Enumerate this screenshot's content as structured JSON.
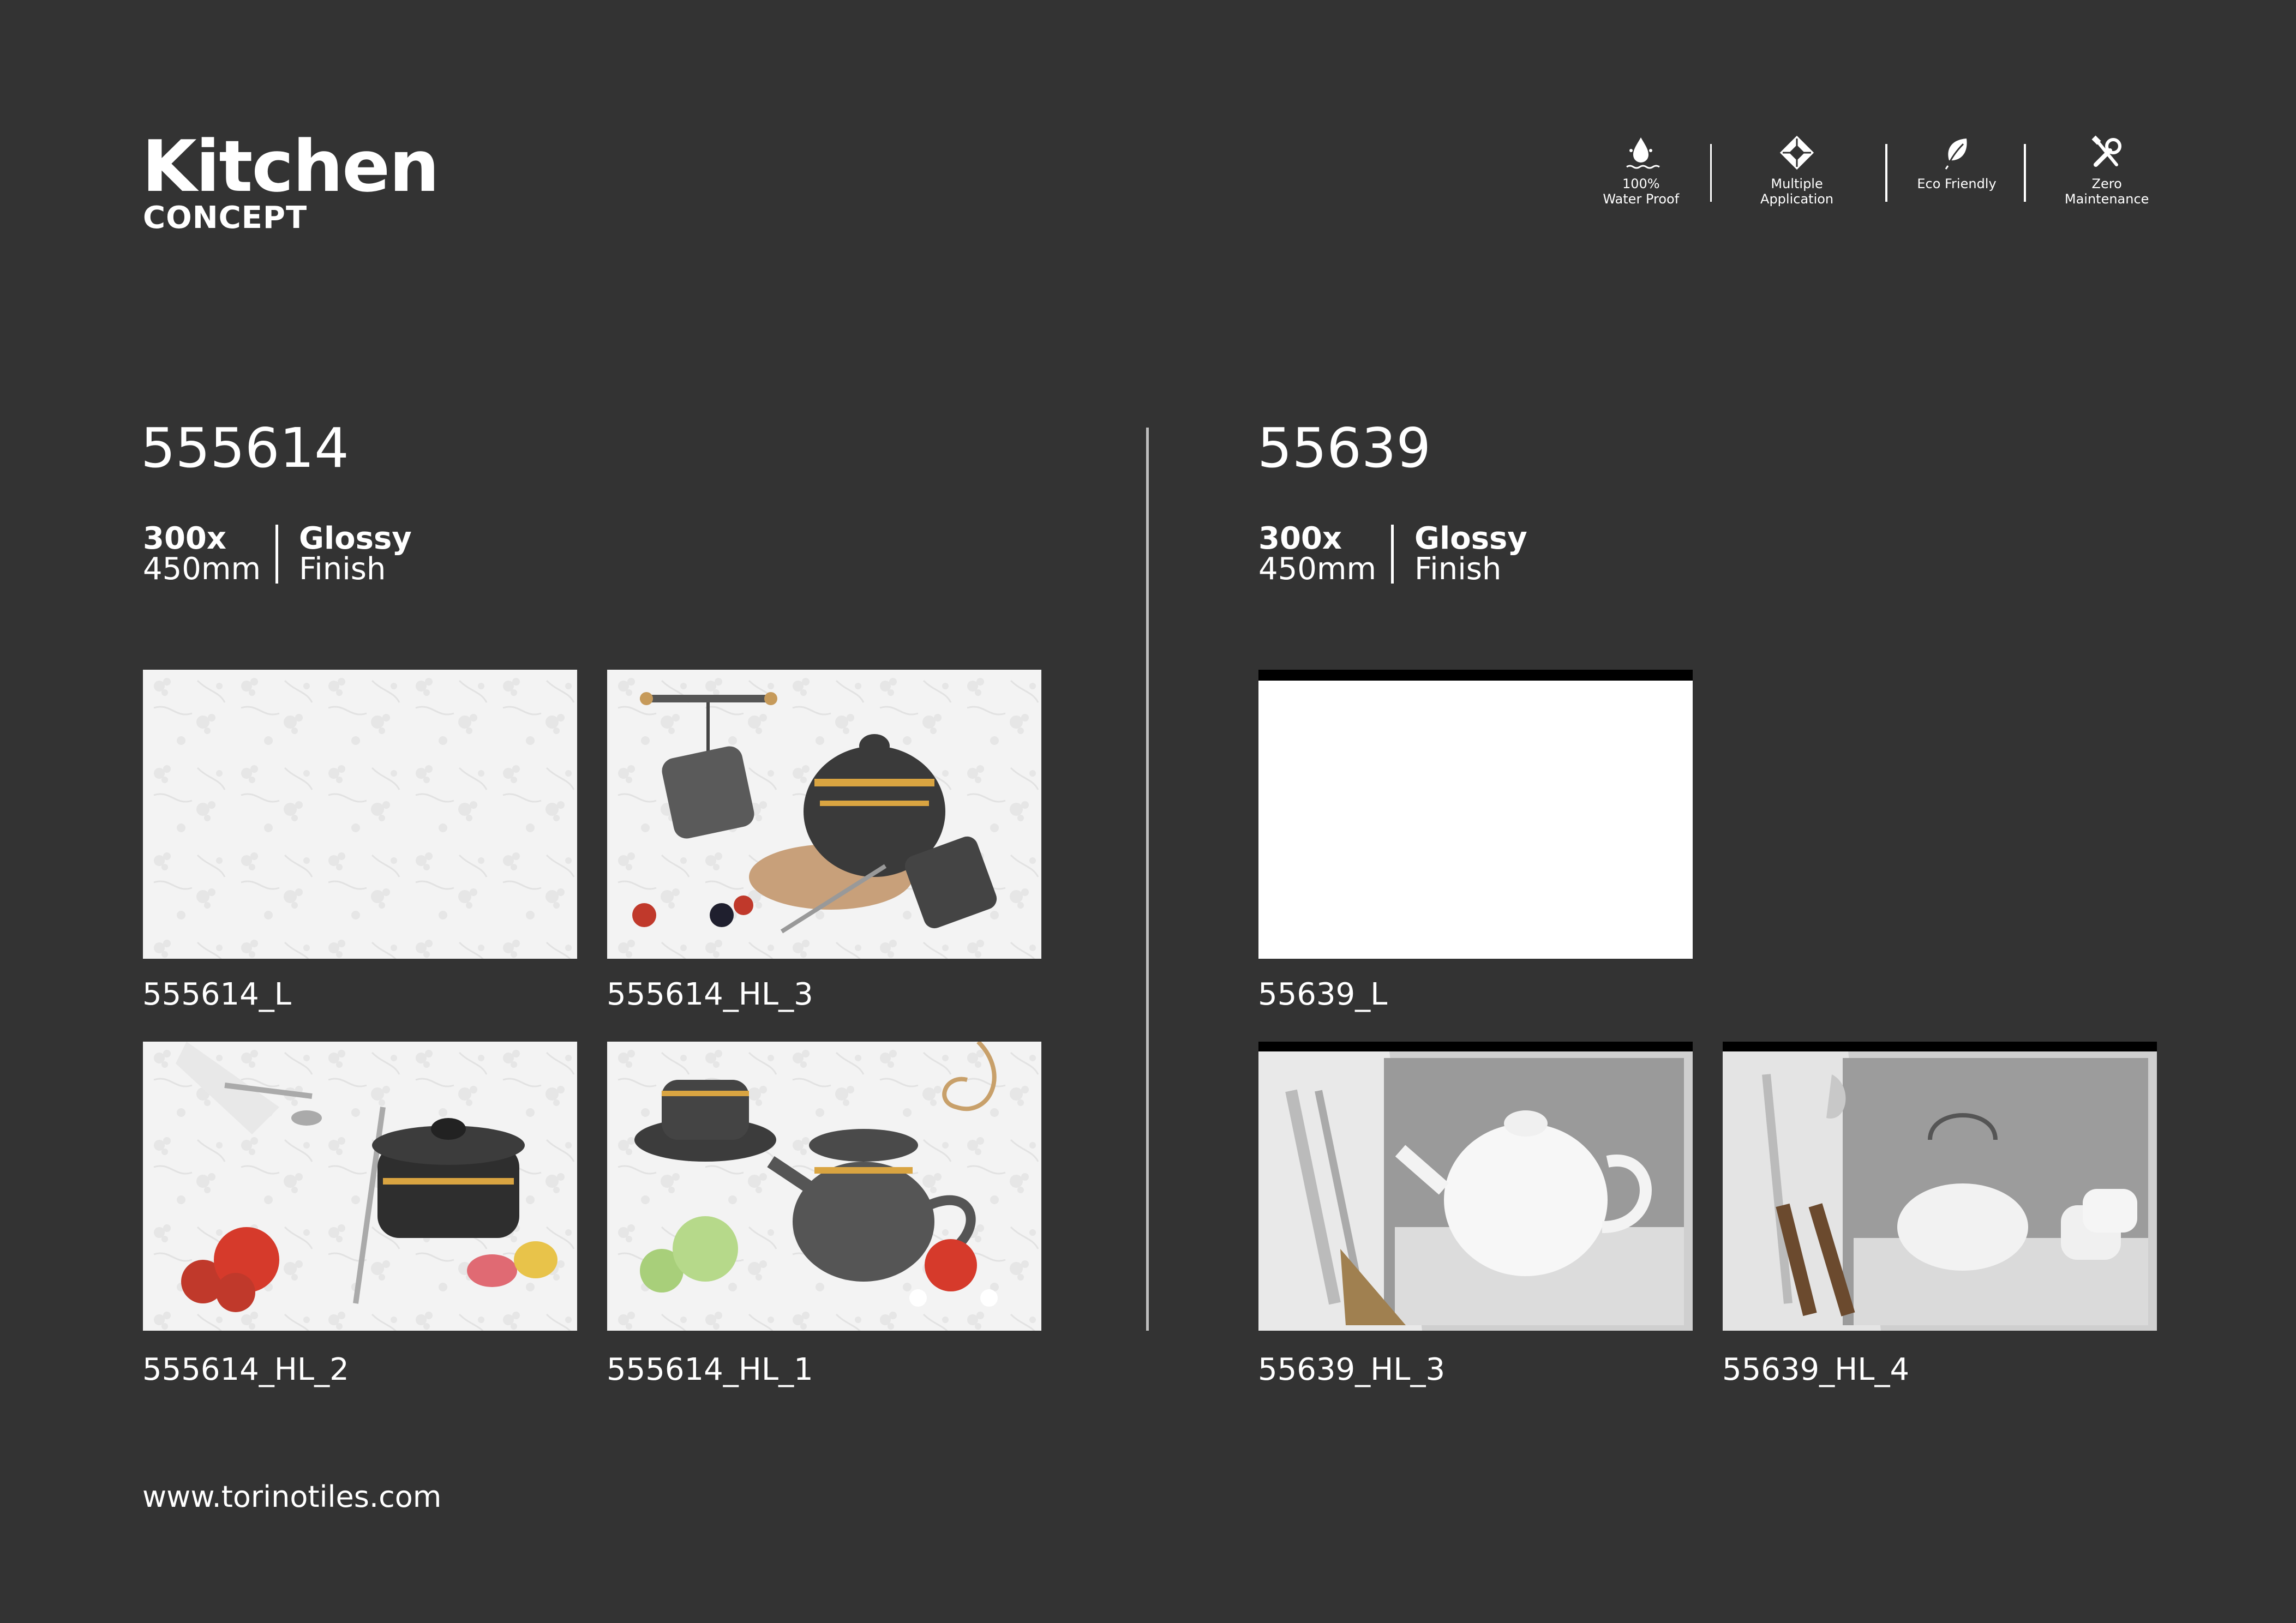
{
  "brand": {
    "title": "Kitchen",
    "subtitle": "CONCEPT"
  },
  "features": [
    {
      "icon": "water-drop-icon",
      "label": "100%\nWater Proof"
    },
    {
      "icon": "multiple-application-icon",
      "label": "Multiple Application"
    },
    {
      "icon": "leaf-icon",
      "label": "Eco Friendly"
    },
    {
      "icon": "tools-icon",
      "label": "Zero Maintenance"
    }
  ],
  "sections": [
    {
      "code": "555614",
      "size_line1": "300x",
      "size_line2": "450mm",
      "finish_line1": "Glossy",
      "finish_line2": "Finish",
      "tiles": [
        "555614_L",
        "555614_HL_3",
        "555614_HL_2",
        "555614_HL_1"
      ]
    },
    {
      "code": "55639",
      "size_line1": "300x",
      "size_line2": "450mm",
      "finish_line1": "Glossy",
      "finish_line2": "Finish",
      "tiles": [
        "55639_L",
        "55639_HL_3",
        "55639_HL_4"
      ]
    }
  ],
  "website": "www.torinotiles.com",
  "colors": {
    "background": "#333333",
    "text": "#ffffff",
    "accent_gold": "#d9a441"
  }
}
